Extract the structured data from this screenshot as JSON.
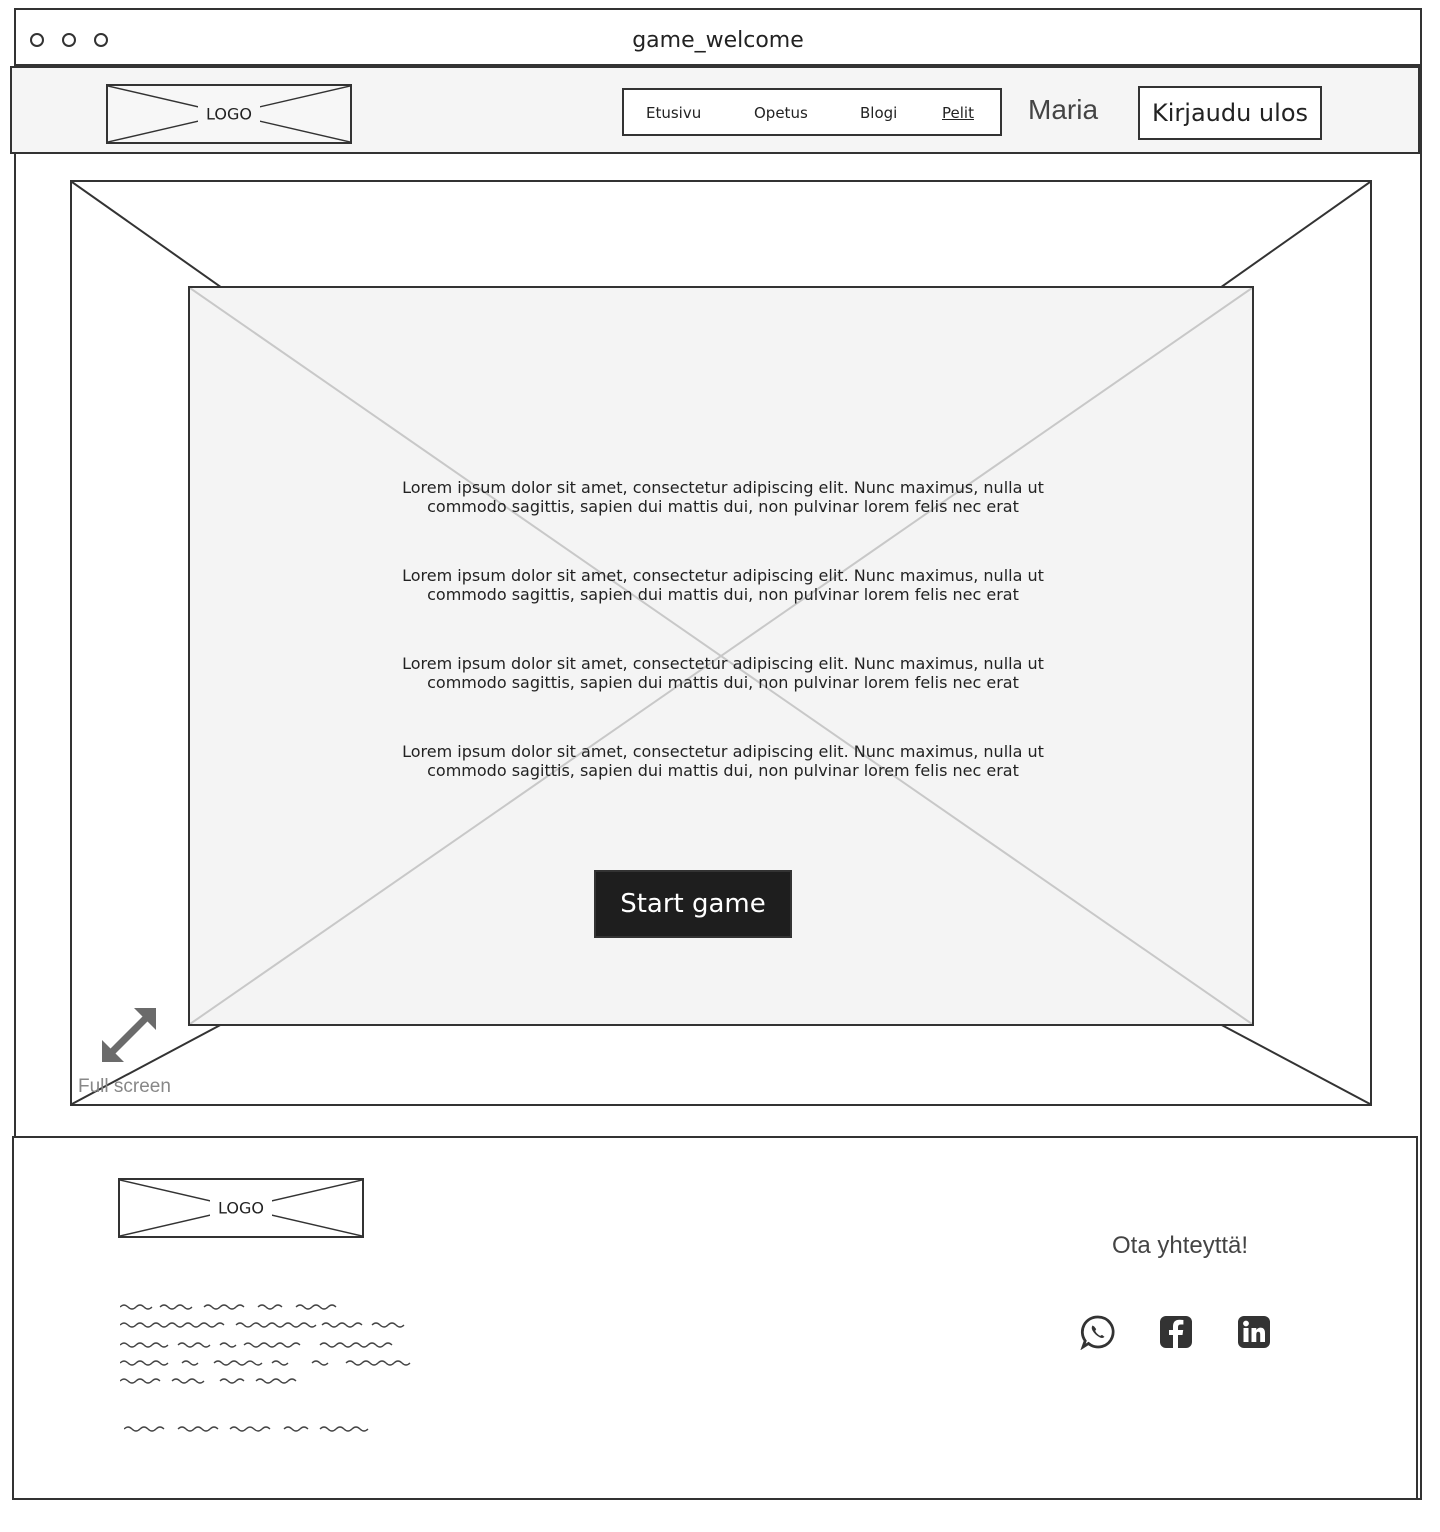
{
  "window": {
    "title": "game_welcome"
  },
  "header": {
    "logo_label": "LOGO",
    "nav": [
      "Etusivu",
      "Opetus",
      "Blogi",
      "Pelit"
    ],
    "active_nav": "Pelit",
    "username": "Maria",
    "logout_label": "Kirjaudu ulos"
  },
  "game": {
    "paragraphs": [
      {
        "line1": "Lorem ipsum dolor sit amet, consectetur adipiscing elit. Nunc maximus, nulla ut",
        "line2": "commodo sagittis, sapien dui mattis dui, non pulvinar lorem felis nec erat"
      },
      {
        "line1": "Lorem ipsum dolor sit amet, consectetur adipiscing elit. Nunc maximus, nulla ut",
        "line2": "commodo sagittis, sapien dui mattis dui, non pulvinar lorem felis nec erat"
      },
      {
        "line1": "Lorem ipsum dolor sit amet, consectetur adipiscing elit. Nunc maximus, nulla ut",
        "line2": "commodo sagittis, sapien dui mattis dui, non pulvinar lorem felis nec erat"
      },
      {
        "line1": "Lorem ipsum dolor sit amet, consectetur adipiscing elit. Nunc maximus, nulla ut",
        "line2": "commodo sagittis, sapien dui mattis dui, non pulvinar lorem felis nec erat"
      }
    ],
    "start_label": "Start game",
    "fullscreen_label": "Full screen",
    "fullscreen_icon": "expand-arrows-icon"
  },
  "footer": {
    "logo_label": "LOGO",
    "contact_label": "Ota yhteyttä!",
    "social_icons": [
      "whatsapp-icon",
      "facebook-icon",
      "linkedin-icon"
    ]
  },
  "colors": {
    "dark_button": "#1e1e1e",
    "header_bg": "#f5f5f5",
    "placeholder_bg": "#f4f4f4"
  }
}
